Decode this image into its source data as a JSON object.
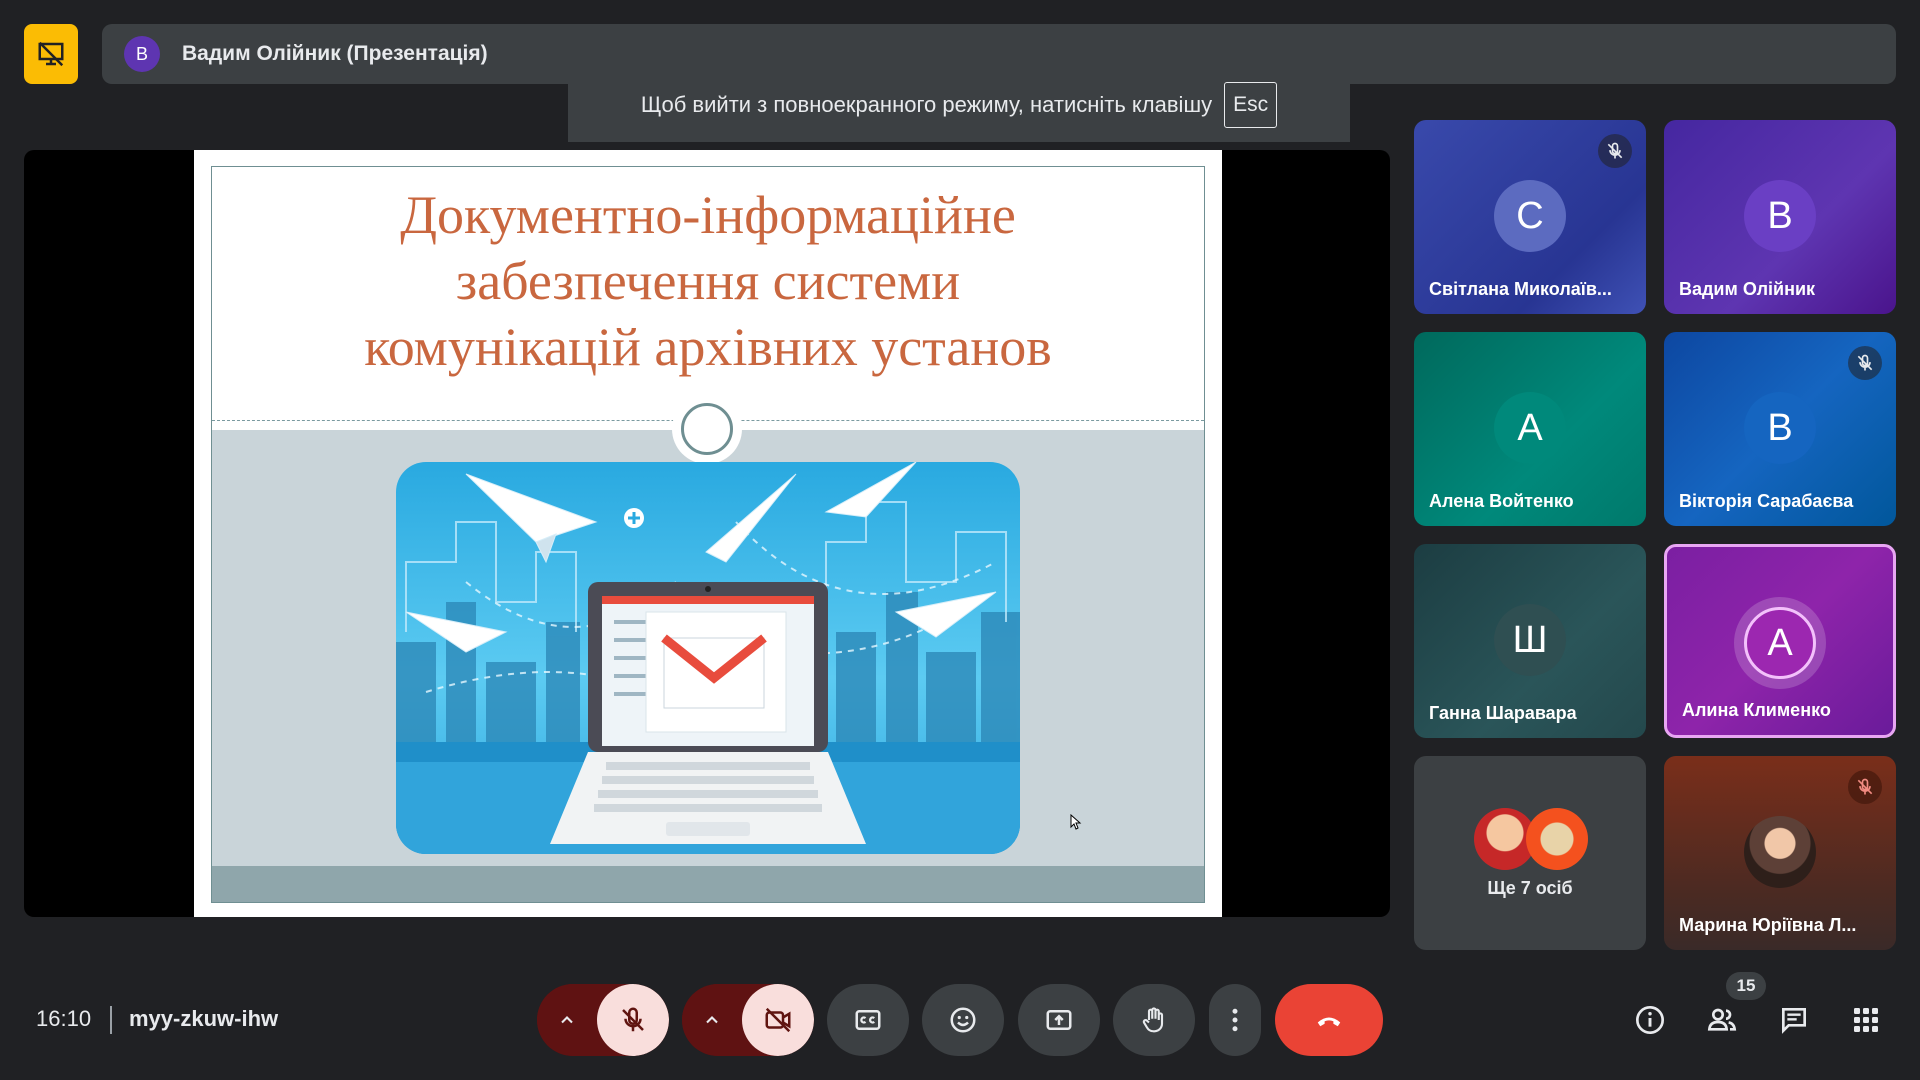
{
  "header": {
    "presenter_initial": "В",
    "presentation_title": "Вадим Олійник (Презентація)"
  },
  "fullscreen_notice": {
    "text": "Щоб вийти з повноекранного режиму, натисніть клавішу",
    "key": "Esc"
  },
  "slide": {
    "title_lines": [
      "Документно-інформаційне",
      "забезпечення системи",
      "комунікацій архівних установ"
    ],
    "title_color": "#c9673f"
  },
  "participants": [
    {
      "initial": "С",
      "name": "Світлана Миколаїв...",
      "muted": true,
      "accent": "#5c6bc0"
    },
    {
      "initial": "В",
      "name": "Вадим Олійник",
      "muted": false,
      "accent": "#6a3fc4"
    },
    {
      "initial": "А",
      "name": "Алена Войтенко",
      "muted": false,
      "accent": "#00897b"
    },
    {
      "initial": "В",
      "name": "Вікторія Сарабаєва",
      "muted": true,
      "accent": "#1565c0"
    },
    {
      "initial": "Ш",
      "name": "Ганна Шаравара",
      "muted": false,
      "accent": "#2f4f52"
    },
    {
      "initial": "А",
      "name": "Алина Клименко",
      "muted": false,
      "accent": "#9c27b0",
      "speaking": true
    },
    {
      "name": "Марина Юріївна Л...",
      "muted": true,
      "has_photo": true
    }
  ],
  "more_tile": {
    "label": "Ще 7 осіб"
  },
  "footer": {
    "time": "16:10",
    "meeting_code": "myy-zkuw-ihw",
    "participant_count": "15"
  },
  "icons": {
    "present": "presentation-off-icon",
    "mic": "mic-off-icon",
    "camera": "videocam-off-icon",
    "captions": "closed-captions-icon",
    "emoji": "emoji-icon",
    "present_screen": "present-to-all-icon",
    "raise_hand": "raise-hand-icon",
    "more": "more-vert-icon",
    "hangup": "call-end-icon",
    "info": "info-icon",
    "people": "people-icon",
    "chat": "chat-icon",
    "activities": "apps-icon"
  },
  "colors": {
    "background": "#202124",
    "surface": "#3c4043",
    "danger": "#ea4335",
    "muted_control_bg": "#f9dedc",
    "muted_control_dark": "#5f1212",
    "present_badge": "#fbbc04"
  }
}
